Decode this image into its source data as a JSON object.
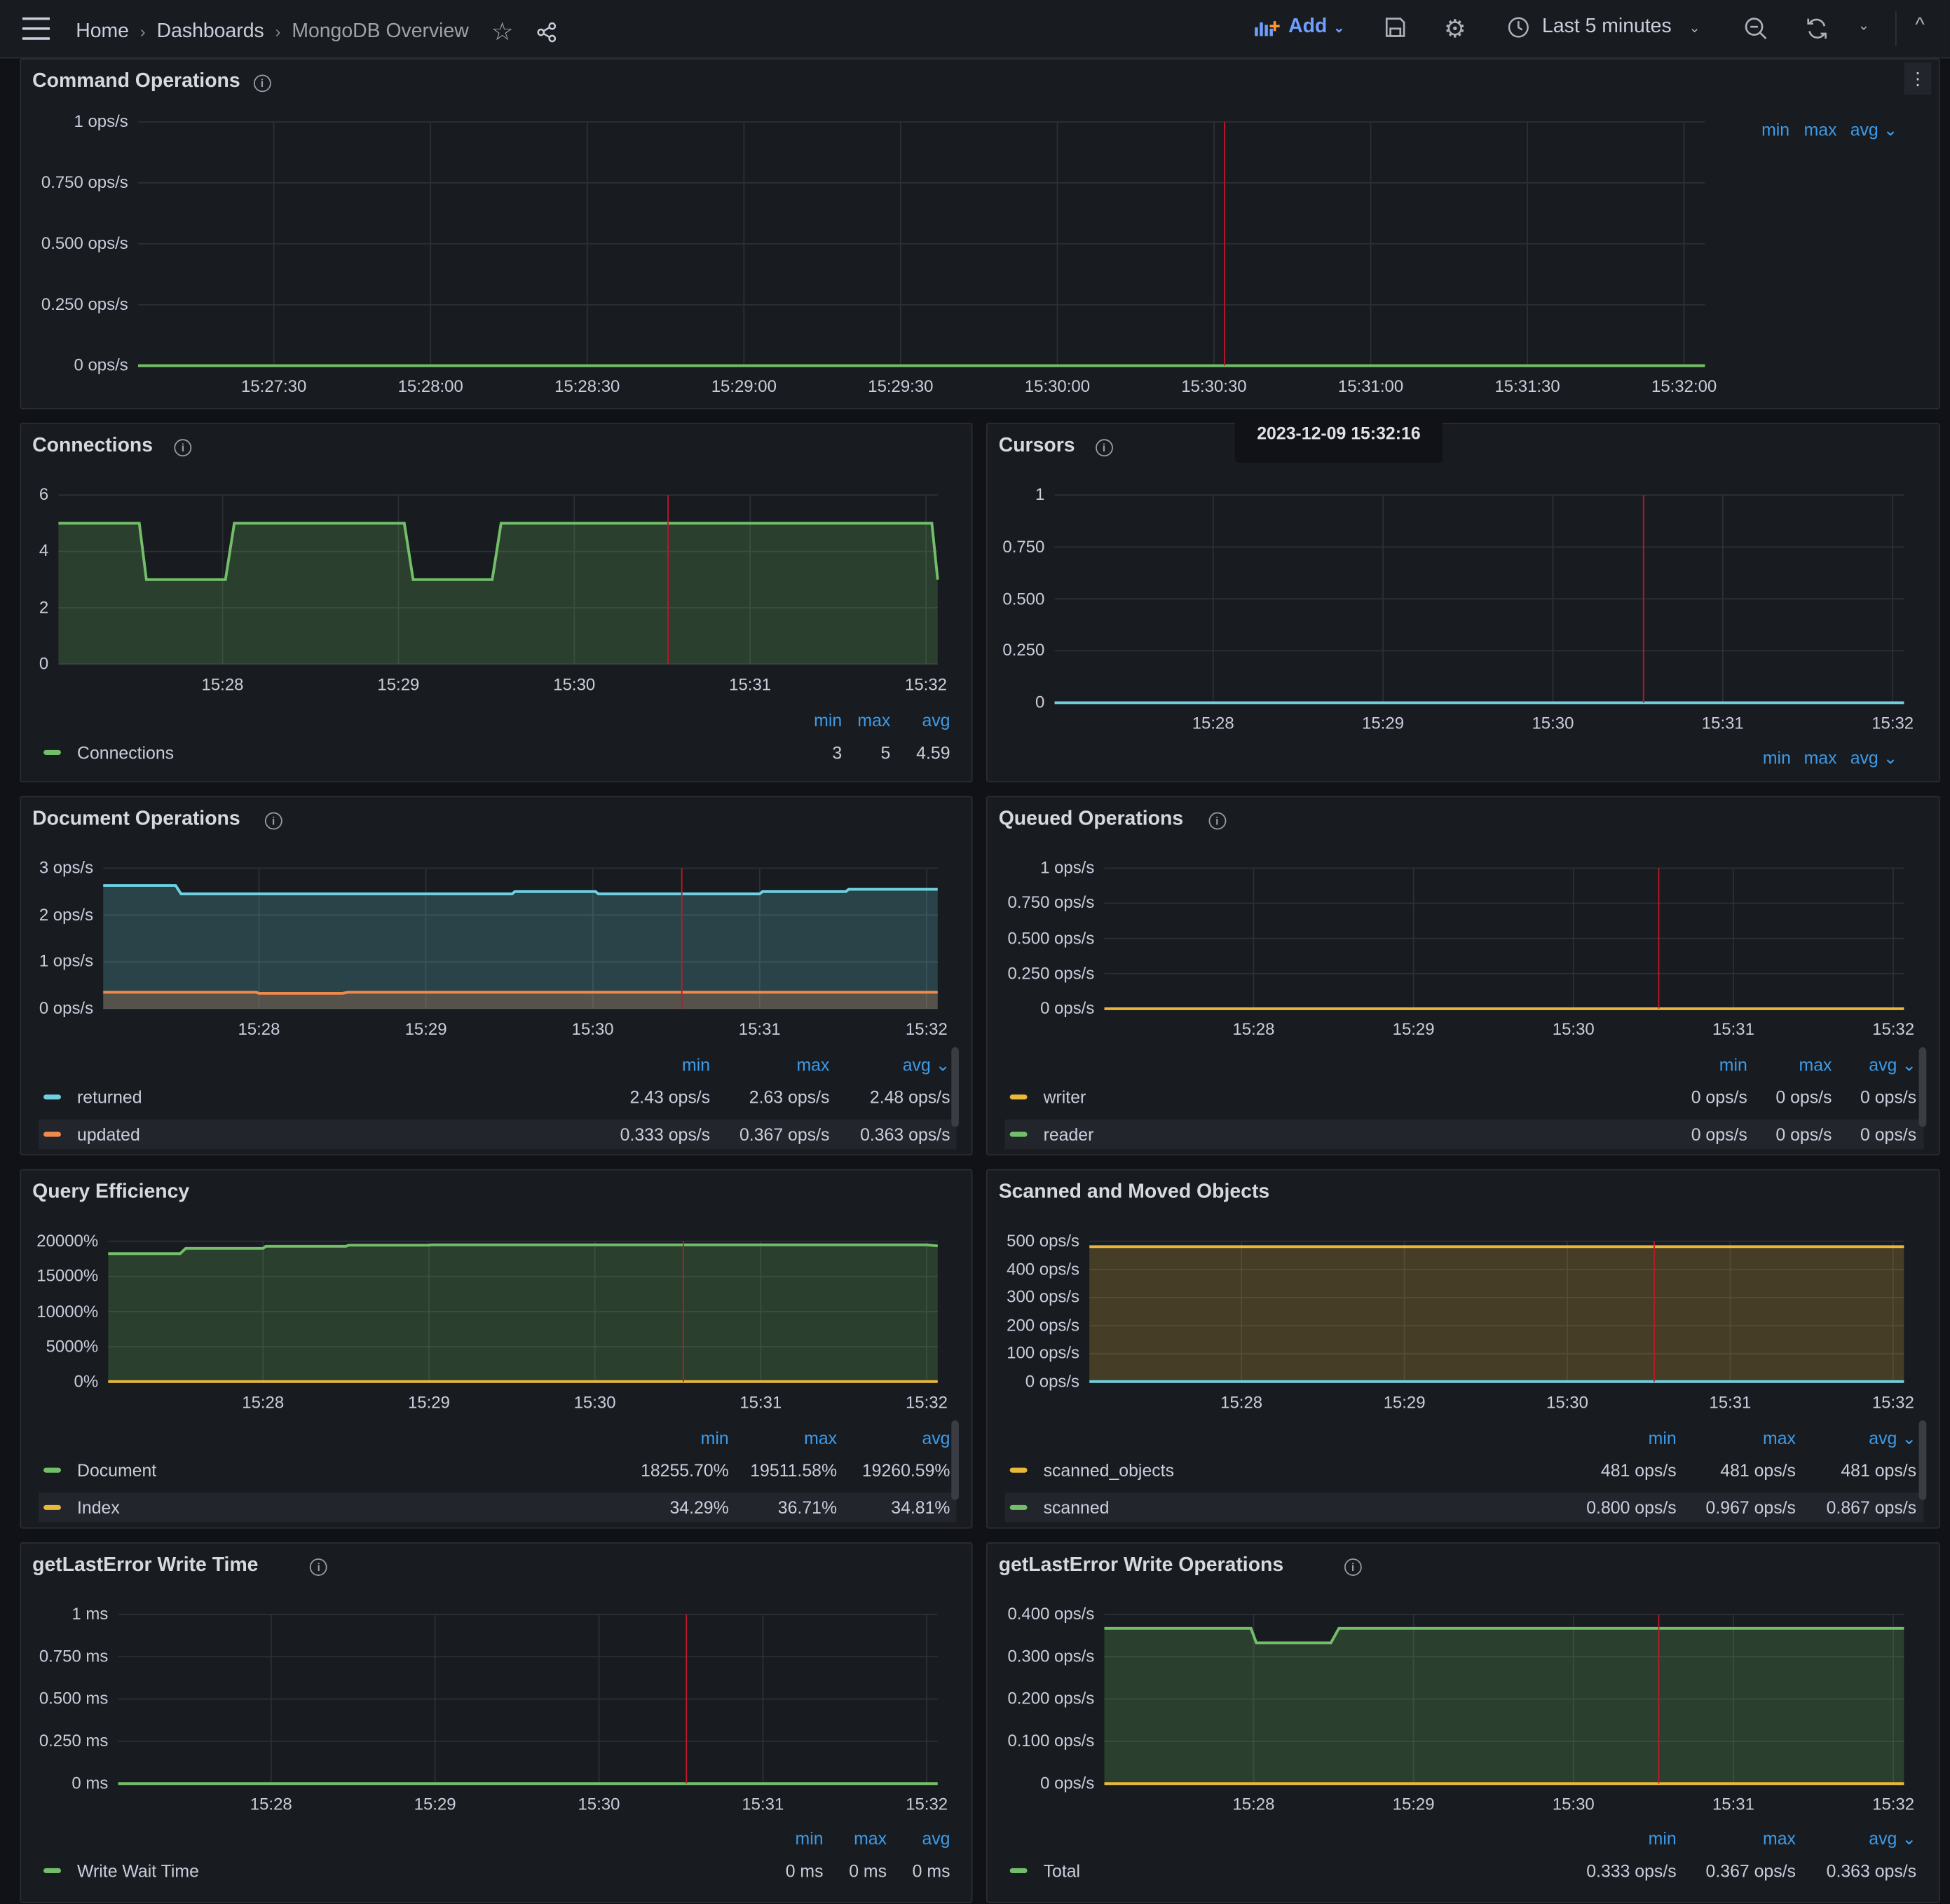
{
  "topbar": {
    "breadcrumb": [
      "Home",
      "Dashboards",
      "MongoDB Overview"
    ],
    "add_label": "Add",
    "time_range": "Last 5 minutes"
  },
  "time_window": {
    "start": "15:27:04",
    "end": "15:32:04",
    "cursor_marker": "15:30:32"
  },
  "colors": {
    "green": "#73bf69",
    "cyan": "#6ed0e0",
    "orange": "#ef8a4c",
    "yellow": "#eab839",
    "marker": "#c4162a",
    "legend_header": "#3d9be9"
  },
  "tooltip": "2023-12-09 15:32:16",
  "panels": [
    {
      "id": "command_operations",
      "title": "Command Operations",
      "info": true,
      "y_ticks": [
        "0 ops/s",
        "0.250 ops/s",
        "0.500 ops/s",
        "0.750 ops/s",
        "1 ops/s"
      ],
      "y_range": [
        0,
        1
      ],
      "x_ticks": [
        "15:27:30",
        "15:28:00",
        "15:28:30",
        "15:29:00",
        "15:29:30",
        "15:30:00",
        "15:30:30",
        "15:31:00",
        "15:31:30",
        "15:32:00"
      ],
      "legend": {
        "headers": [
          "min",
          "max",
          "avg ⌄"
        ],
        "rows": []
      },
      "series": [
        {
          "name": "",
          "color": "#73bf69",
          "fill": false,
          "points": [
            [
              0,
              0
            ],
            [
              300,
              0
            ]
          ]
        }
      ]
    },
    {
      "id": "connections",
      "title": "Connections",
      "info": true,
      "y_ticks": [
        "0",
        "2",
        "4",
        "6"
      ],
      "y_range": [
        0,
        6
      ],
      "x_ticks": [
        "15:28",
        "15:29",
        "15:30",
        "15:31",
        "15:32"
      ],
      "legend": {
        "headers": [
          "min",
          "max",
          "avg"
        ],
        "rows": [
          {
            "name": "Connections",
            "color": "#73bf69",
            "values": [
              "3",
              "5",
              "4.59"
            ]
          }
        ]
      },
      "series": [
        {
          "name": "Connections",
          "color": "#73bf69",
          "fill": true,
          "points": [
            [
              0,
              5
            ],
            [
              27.6,
              5
            ],
            [
              30,
              3
            ],
            [
              57,
              3
            ],
            [
              60,
              5
            ],
            [
              118,
              5
            ],
            [
              121,
              3
            ],
            [
              148,
              3
            ],
            [
              151,
              5
            ],
            [
              298,
              5
            ],
            [
              300,
              3
            ]
          ]
        }
      ]
    },
    {
      "id": "cursors",
      "title": "Cursors",
      "info": true,
      "y_ticks": [
        "0",
        "0.250",
        "0.500",
        "0.750",
        "1"
      ],
      "y_range": [
        0,
        1
      ],
      "x_ticks": [
        "15:28",
        "15:29",
        "15:30",
        "15:31",
        "15:32"
      ],
      "legend": {
        "headers": [
          "min",
          "max",
          "avg ⌄"
        ],
        "rows": []
      },
      "series": [
        {
          "name": "",
          "color": "#6ed0e0",
          "fill": false,
          "points": [
            [
              0,
              0
            ],
            [
              300,
              0
            ]
          ]
        }
      ]
    },
    {
      "id": "document_operations",
      "title": "Document Operations",
      "info": true,
      "y_ticks": [
        "0 ops/s",
        "1 ops/s",
        "2 ops/s",
        "3 ops/s"
      ],
      "y_range": [
        0,
        3
      ],
      "x_ticks": [
        "15:28",
        "15:29",
        "15:30",
        "15:31",
        "15:32"
      ],
      "legend": {
        "headers": [
          "min",
          "max",
          "avg ⌄"
        ],
        "rows": [
          {
            "name": "returned",
            "color": "#6ed0e0",
            "values": [
              "2.43 ops/s",
              "2.63 ops/s",
              "2.48 ops/s"
            ]
          },
          {
            "name": "updated",
            "color": "#ef8a4c",
            "values": [
              "0.333 ops/s",
              "0.367 ops/s",
              "0.363 ops/s"
            ]
          }
        ]
      },
      "series": [
        {
          "name": "returned",
          "color": "#6ed0e0",
          "fill": true,
          "points": [
            [
              0,
              2.63
            ],
            [
              26,
              2.63
            ],
            [
              28,
              2.45
            ],
            [
              147,
              2.45
            ],
            [
              148,
              2.5
            ],
            [
              177,
              2.5
            ],
            [
              178,
              2.45
            ],
            [
              236,
              2.45
            ],
            [
              237,
              2.5
            ],
            [
              267,
              2.5
            ],
            [
              268,
              2.55
            ],
            [
              300,
              2.55
            ]
          ]
        },
        {
          "name": "updated",
          "color": "#ef8a4c",
          "fill": true,
          "points": [
            [
              0,
              0.35
            ],
            [
              55,
              0.35
            ],
            [
              56,
              0.33
            ],
            [
              86,
              0.33
            ],
            [
              88,
              0.35
            ],
            [
              300,
              0.35
            ]
          ]
        }
      ]
    },
    {
      "id": "queued_operations",
      "title": "Queued Operations",
      "info": true,
      "y_ticks": [
        "0 ops/s",
        "0.250 ops/s",
        "0.500 ops/s",
        "0.750 ops/s",
        "1 ops/s"
      ],
      "y_range": [
        0,
        1
      ],
      "x_ticks": [
        "15:28",
        "15:29",
        "15:30",
        "15:31",
        "15:32"
      ],
      "legend": {
        "headers": [
          "min",
          "max",
          "avg ⌄"
        ],
        "rows": [
          {
            "name": "writer",
            "color": "#eab839",
            "values": [
              "0 ops/s",
              "0 ops/s",
              "0 ops/s"
            ]
          },
          {
            "name": "reader",
            "color": "#73bf69",
            "values": [
              "0 ops/s",
              "0 ops/s",
              "0 ops/s"
            ]
          }
        ]
      },
      "series": [
        {
          "name": "writer",
          "color": "#eab839",
          "fill": false,
          "points": [
            [
              0,
              0
            ],
            [
              300,
              0
            ]
          ]
        }
      ]
    },
    {
      "id": "query_efficiency",
      "title": "Query Efficiency",
      "info": false,
      "y_ticks": [
        "0%",
        "5000%",
        "10000%",
        "15000%",
        "20000%"
      ],
      "y_range": [
        0,
        20000
      ],
      "x_ticks": [
        "15:28",
        "15:29",
        "15:30",
        "15:31",
        "15:32"
      ],
      "legend": {
        "headers": [
          "min",
          "max",
          "avg"
        ],
        "rows": [
          {
            "name": "Document",
            "color": "#73bf69",
            "values": [
              "18255.70%",
              "19511.58%",
              "19260.59%"
            ]
          },
          {
            "name": "Index",
            "color": "#eab839",
            "values": [
              "34.29%",
              "36.71%",
              "34.81%"
            ]
          }
        ]
      },
      "series": [
        {
          "name": "Document",
          "color": "#73bf69",
          "fill": true,
          "points": [
            [
              0,
              18255
            ],
            [
              26,
              18255
            ],
            [
              28,
              19000
            ],
            [
              56,
              19000
            ],
            [
              57,
              19300
            ],
            [
              86,
              19300
            ],
            [
              87,
              19450
            ],
            [
              116,
              19450
            ],
            [
              117,
              19511
            ],
            [
              296,
              19511
            ],
            [
              300,
              19350
            ]
          ]
        },
        {
          "name": "Index",
          "color": "#eab839",
          "fill": false,
          "points": [
            [
              0,
              35
            ],
            [
              300,
              35
            ]
          ]
        }
      ]
    },
    {
      "id": "scanned_and_moved_objects",
      "title": "Scanned and Moved Objects",
      "info": false,
      "y_ticks": [
        "0 ops/s",
        "100 ops/s",
        "200 ops/s",
        "300 ops/s",
        "400 ops/s",
        "500 ops/s"
      ],
      "y_range": [
        0,
        500
      ],
      "x_ticks": [
        "15:28",
        "15:29",
        "15:30",
        "15:31",
        "15:32"
      ],
      "legend": {
        "headers": [
          "min",
          "max",
          "avg ⌄"
        ],
        "rows": [
          {
            "name": "scanned_objects",
            "color": "#eab839",
            "values": [
              "481 ops/s",
              "481 ops/s",
              "481 ops/s"
            ]
          },
          {
            "name": "scanned",
            "color": "#73bf69",
            "values": [
              "0.800 ops/s",
              "0.967 ops/s",
              "0.867 ops/s"
            ]
          }
        ]
      },
      "series": [
        {
          "name": "scanned_objects",
          "color": "#eab839",
          "fill": true,
          "points": [
            [
              0,
              481
            ],
            [
              300,
              481
            ]
          ]
        },
        {
          "name": "",
          "color": "#6ed0e0",
          "fill": false,
          "points": [
            [
              0,
              0.8
            ],
            [
              300,
              0.9
            ]
          ]
        }
      ]
    },
    {
      "id": "getlasterror_write_time",
      "title": "getLastError Write Time",
      "info": true,
      "y_ticks": [
        "0 ms",
        "0.250 ms",
        "0.500 ms",
        "0.750 ms",
        "1 ms"
      ],
      "y_range": [
        0,
        1
      ],
      "x_ticks": [
        "15:28",
        "15:29",
        "15:30",
        "15:31",
        "15:32"
      ],
      "legend": {
        "headers": [
          "min",
          "max",
          "avg"
        ],
        "rows": [
          {
            "name": "Write Wait Time",
            "color": "#73bf69",
            "values": [
              "0 ms",
              "0 ms",
              "0 ms"
            ]
          }
        ]
      },
      "series": [
        {
          "name": "Write Wait Time",
          "color": "#73bf69",
          "fill": false,
          "points": [
            [
              0,
              0
            ],
            [
              300,
              0
            ]
          ]
        }
      ]
    },
    {
      "id": "getlasterror_write_operations",
      "title": "getLastError Write Operations",
      "info": true,
      "y_ticks": [
        "0 ops/s",
        "0.100 ops/s",
        "0.200 ops/s",
        "0.300 ops/s",
        "0.400 ops/s"
      ],
      "y_range": [
        0,
        0.4
      ],
      "x_ticks": [
        "15:28",
        "15:29",
        "15:30",
        "15:31",
        "15:32"
      ],
      "legend": {
        "headers": [
          "min",
          "max",
          "avg ⌄"
        ],
        "rows": [
          {
            "name": "Total",
            "color": "#73bf69",
            "values": [
              "0.333 ops/s",
              "0.367 ops/s",
              "0.363 ops/s"
            ]
          }
        ]
      },
      "series": [
        {
          "name": "Total",
          "color": "#73bf69",
          "fill": true,
          "points": [
            [
              0,
              0.367
            ],
            [
              55,
              0.367
            ],
            [
              57,
              0.333
            ],
            [
              85,
              0.333
            ],
            [
              88,
              0.367
            ],
            [
              300,
              0.367
            ]
          ]
        },
        {
          "name": "",
          "color": "#eab839",
          "fill": false,
          "points": [
            [
              0,
              0
            ],
            [
              300,
              0
            ]
          ]
        }
      ]
    }
  ]
}
